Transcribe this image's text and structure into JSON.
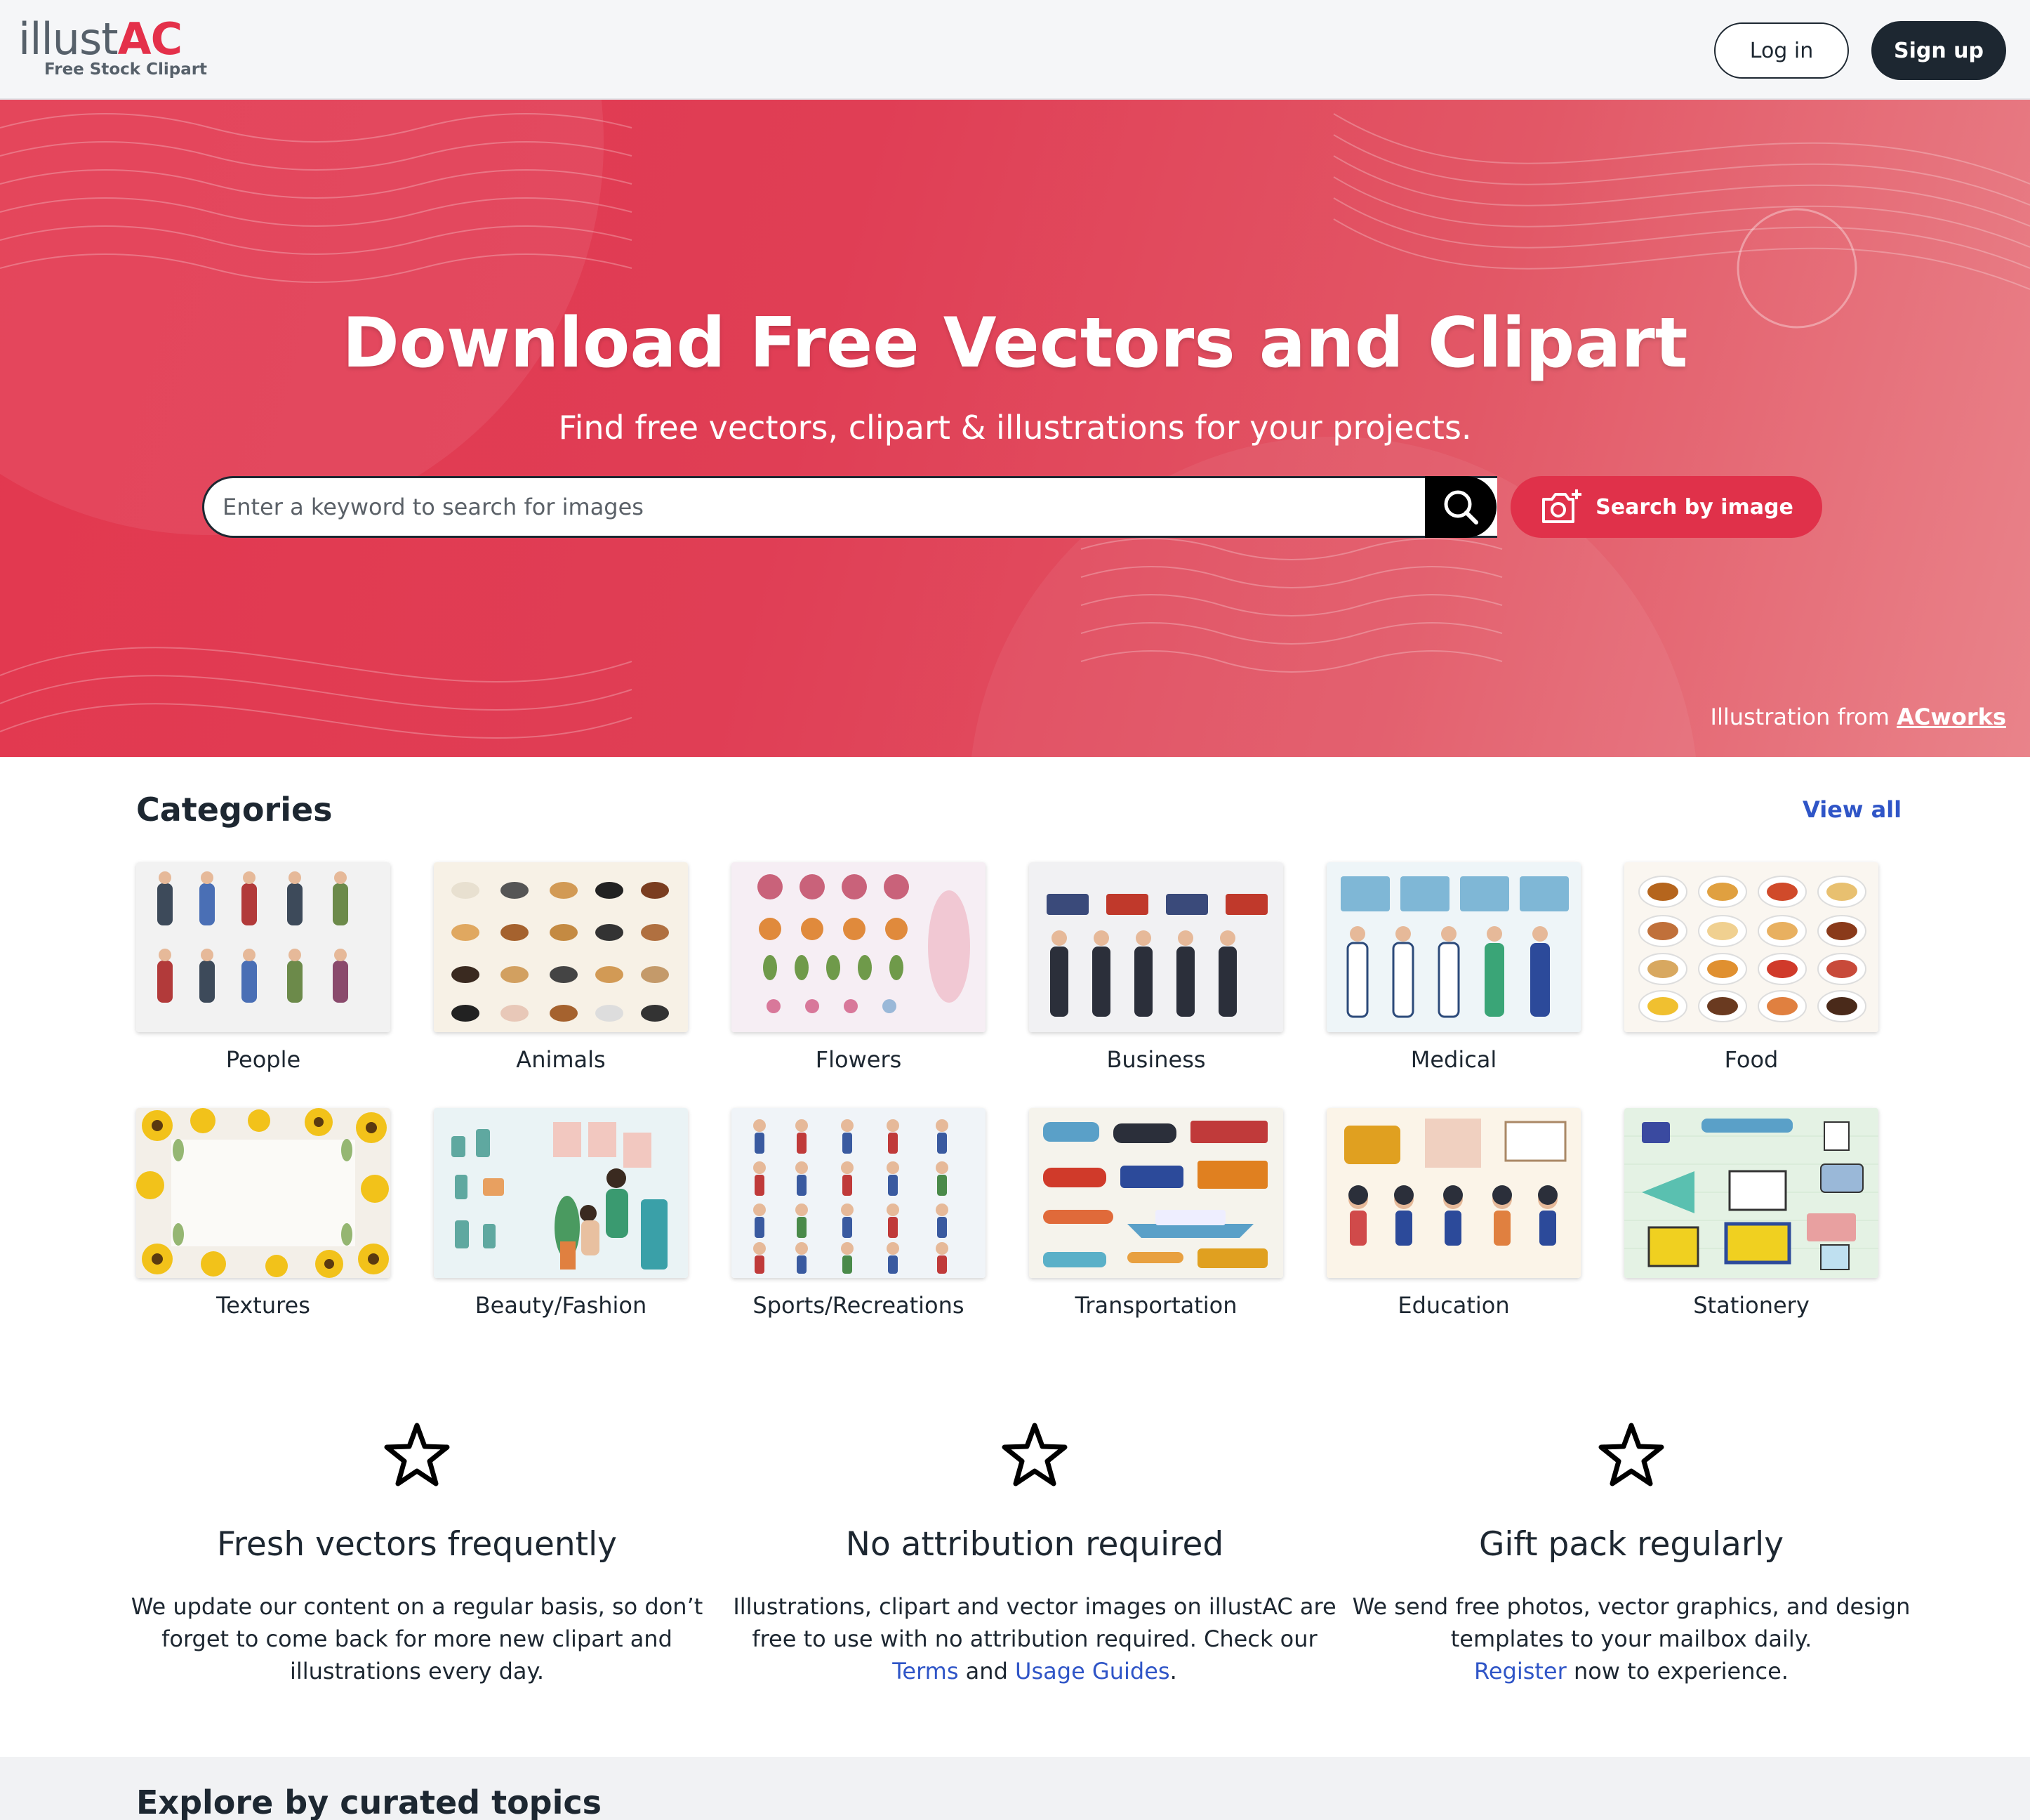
{
  "brand": {
    "logo_prefix": "illust",
    "logo_suffix": "AC",
    "tagline": "Free Stock Clipart",
    "accent_color": "#e4304a",
    "dark_color": "#1d2731",
    "link_color": "#2f55c7"
  },
  "header": {
    "login_label": "Log in",
    "signup_label": "Sign up"
  },
  "hero": {
    "title": "Download Free Vectors and Clipart",
    "subtitle": "Find free vectors, clipart & illustrations for your projects.",
    "search_placeholder": "Enter a keyword to search for images",
    "search_icon": "search-icon",
    "image_search_label": "Search by image",
    "image_search_icon": "camera-plus-icon",
    "credit_prefix": "Illustration from",
    "credit_link": "ACworks"
  },
  "categories": {
    "title": "Categories",
    "view_all": "View all",
    "items": [
      {
        "label": "People"
      },
      {
        "label": "Animals"
      },
      {
        "label": "Flowers"
      },
      {
        "label": "Business"
      },
      {
        "label": "Medical"
      },
      {
        "label": "Food"
      },
      {
        "label": "Textures"
      },
      {
        "label": "Beauty/Fashion"
      },
      {
        "label": "Sports/Recreations"
      },
      {
        "label": "Transportation"
      },
      {
        "label": "Education"
      },
      {
        "label": "Stationery"
      }
    ]
  },
  "features": [
    {
      "icon": "star-icon",
      "title": "Fresh vectors frequently",
      "text": "We update our content on a regular basis, so don’t forget to come back for more new clipart and illustrations every day."
    },
    {
      "icon": "star-icon",
      "title": "No attribution required",
      "text_before": "Illustrations, clipart and vector images on illustAC are free to use with no attribution required. Check our",
      "link1": "Terms",
      "text_mid": "and",
      "link2": "Usage Guides",
      "text_after": "."
    },
    {
      "icon": "star-icon",
      "title": "Gift pack regularly",
      "text_before": "We send free photos, vector graphics, and design templates to your mailbox daily.",
      "link1": "Register",
      "text_after": "now to experience."
    }
  ],
  "curated": {
    "title": "Explore by curated topics"
  }
}
